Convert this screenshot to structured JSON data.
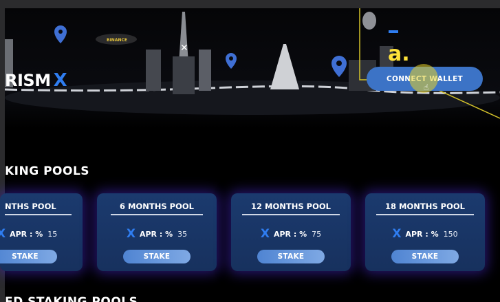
{
  "brand": {
    "name": "RISM",
    "suffix": "X"
  },
  "header": {
    "connect_wallet_label": "CONNECT WALLET",
    "annotation_label": "a.",
    "blimp_label": "BINANCE"
  },
  "staking": {
    "section_title": "KING POOLS",
    "next_section_title": "ED STAKING POOLS",
    "pools": [
      {
        "title": "NTHS POOL",
        "apr_label": "APR : %",
        "apr_value": "15",
        "stake_label": "STAKE"
      },
      {
        "title": "6 MONTHS POOL",
        "apr_label": "APR : %",
        "apr_value": "35",
        "stake_label": "STAKE"
      },
      {
        "title": "12 MONTHS POOL",
        "apr_label": "APR : %",
        "apr_value": "75",
        "stake_label": "STAKE"
      },
      {
        "title": "18 MONTHS POOL",
        "apr_label": "APR : %",
        "apr_value": "150",
        "stake_label": "STAKE"
      }
    ]
  },
  "colors": {
    "accent_blue": "#2f7df0",
    "card_bg": "#1b3a6e",
    "button_blue": "#3c73c6",
    "annotation_yellow": "#ffe23a"
  }
}
